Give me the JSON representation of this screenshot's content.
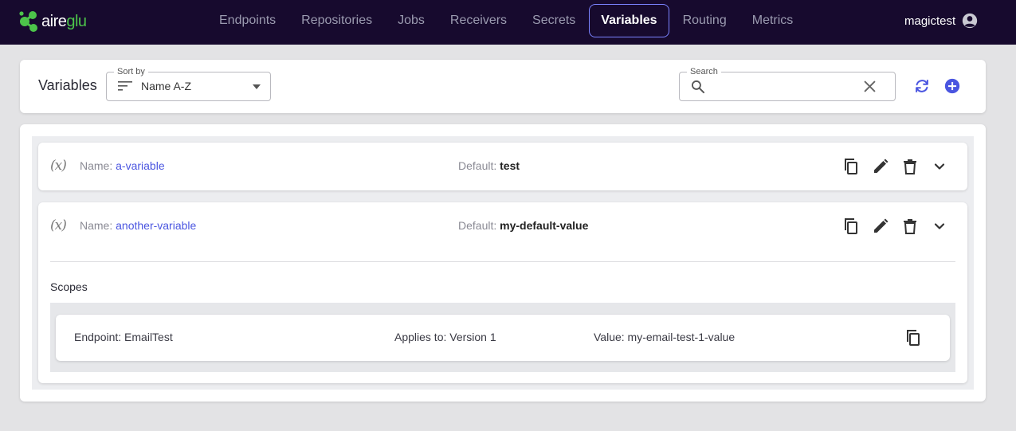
{
  "app": {
    "logo_text_main": "aire",
    "logo_text_accent": "glu",
    "brand_color": "#4cc44a",
    "topbar_color": "#170a2e"
  },
  "nav": {
    "items": [
      {
        "label": "Endpoints"
      },
      {
        "label": "Repositories"
      },
      {
        "label": "Jobs"
      },
      {
        "label": "Receivers"
      },
      {
        "label": "Secrets"
      },
      {
        "label": "Variables",
        "active": true
      },
      {
        "label": "Routing"
      },
      {
        "label": "Metrics"
      }
    ],
    "active_border_color": "#7b83ff"
  },
  "user": {
    "name": "magictest",
    "icon": "account-circle-icon"
  },
  "header": {
    "title": "Variables",
    "sort": {
      "legend": "Sort by",
      "value": "Name A-Z",
      "icon": "sort-lines-icon"
    },
    "search": {
      "legend": "Search",
      "value": "",
      "placeholder": "",
      "icon": "search-icon",
      "clear_icon": "close-icon"
    },
    "actions": [
      {
        "name": "refresh",
        "icon": "refresh-icon"
      },
      {
        "name": "add",
        "icon": "add-circle-icon"
      }
    ],
    "accent_color": "#4a55e0"
  },
  "variables": [
    {
      "icon": "variable-icon",
      "icon_text": "(𝑥)",
      "name_label": "Name:",
      "name": "a-variable",
      "default_label": "Default:",
      "default": "test",
      "expanded": false
    },
    {
      "icon": "variable-icon",
      "icon_text": "(𝑥)",
      "name_label": "Name:",
      "name": "another-variable",
      "default_label": "Default:",
      "default": "my-default-value",
      "expanded": true,
      "scopes_title": "Scopes",
      "scopes": [
        {
          "endpoint": "Endpoint: EmailTest",
          "applies_to": "Applies to: Version 1",
          "value": "Value: my-email-test-1-value"
        }
      ]
    }
  ],
  "row_action_icons": [
    "copy-icon",
    "edit-icon",
    "delete-icon",
    "chevron-down-icon"
  ]
}
